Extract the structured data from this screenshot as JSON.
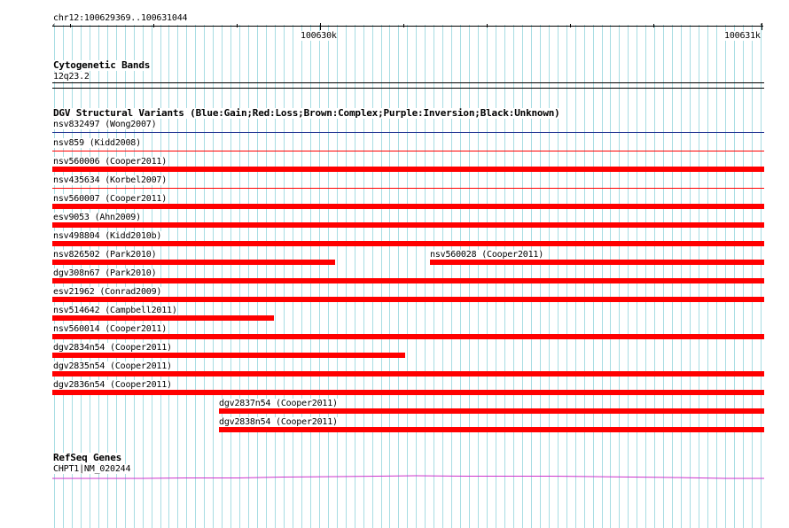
{
  "header": {
    "location": "chr12:100629369..100631044",
    "ticks": [
      "100630k",
      "100631k"
    ]
  },
  "cytoband": {
    "title": "Cytogenetic Bands",
    "band": "12q23.2"
  },
  "dgv": {
    "title": "DGV Structural Variants (Blue:Gain;Red:Loss;Brown:Complex;Purple:Inversion;Black:Unknown)",
    "colors": {
      "gain": "#1a2e8f",
      "loss": "#ff0000"
    },
    "variants": [
      {
        "label": "nsv832497 (Wong2007)"
      },
      {
        "label": "nsv859 (Kidd2008)"
      },
      {
        "label": "nsv560006 (Cooper2011)"
      },
      {
        "label": "nsv435634 (Korbel2007)"
      },
      {
        "label": "nsv560007 (Cooper2011)"
      },
      {
        "label": "esv9053 (Ahn2009)"
      },
      {
        "label": "nsv498804 (Kidd2010b)"
      },
      {
        "label": "nsv826502 (Park2010)"
      },
      {
        "label": "nsv560028 (Cooper2011)"
      },
      {
        "label": "dgv308n67 (Park2010)"
      },
      {
        "label": "esv21962 (Conrad2009)"
      },
      {
        "label": "nsv514642 (Campbell2011)"
      },
      {
        "label": "nsv560014 (Cooper2011)"
      },
      {
        "label": "dgv2834n54 (Cooper2011)"
      },
      {
        "label": "dgv2835n54 (Cooper2011)"
      },
      {
        "label": "dgv2836n54 (Cooper2011)"
      },
      {
        "label": "dgv2837n54 (Cooper2011)"
      },
      {
        "label": "dgv2838n54 (Cooper2011)"
      }
    ]
  },
  "refseq": {
    "title": "RefSeq Genes",
    "gene": "CHPT1|NM_020244",
    "color": "#cc33cc"
  },
  "grid_color": "#a8dde3"
}
